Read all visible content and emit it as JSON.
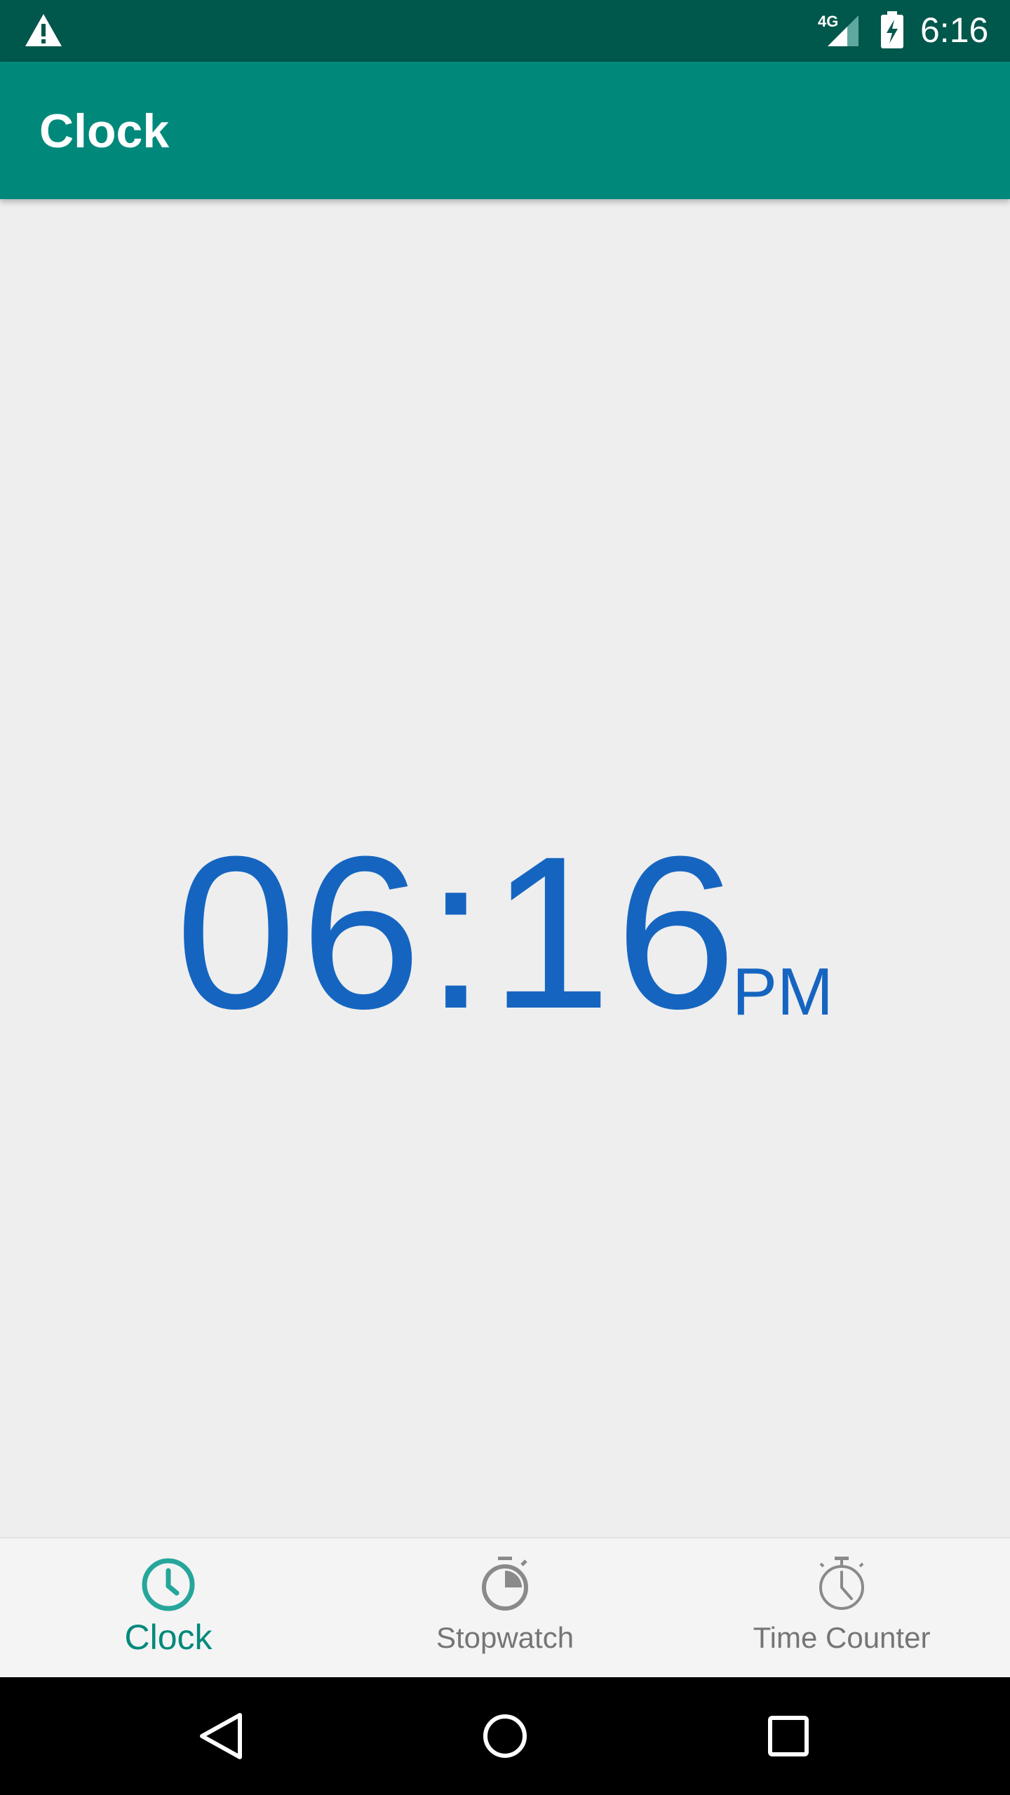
{
  "status_bar": {
    "network": "4G",
    "time": "6:16",
    "icons": [
      "warning-icon",
      "signal-icon",
      "battery-charging-icon"
    ]
  },
  "app_bar": {
    "title": "Clock"
  },
  "clock": {
    "time": "06:16",
    "period": "PM"
  },
  "bottom_nav": {
    "items": [
      {
        "label": "Clock",
        "icon": "clock-icon",
        "active": true
      },
      {
        "label": "Stopwatch",
        "icon": "stopwatch-icon",
        "active": false
      },
      {
        "label": "Time Counter",
        "icon": "timer-icon",
        "active": false
      }
    ]
  },
  "system_nav": {
    "icons": [
      "back-icon",
      "home-icon",
      "recents-icon"
    ]
  },
  "colors": {
    "status_bar": "#00574b",
    "app_bar": "#00897b",
    "clock_text": "#1565c0",
    "active_tab": "#00897b",
    "inactive_tab": "#757575"
  }
}
